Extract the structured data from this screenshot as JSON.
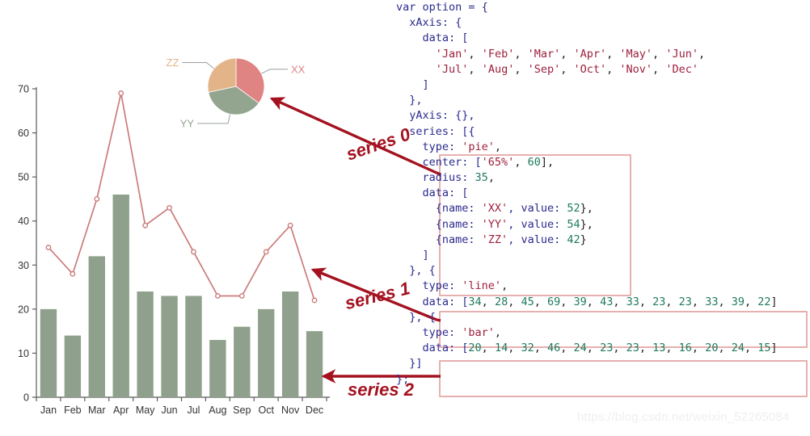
{
  "chart_data": [
    {
      "type": "bar",
      "name": "series 2",
      "categories": [
        "Jan",
        "Feb",
        "Mar",
        "Apr",
        "May",
        "Jun",
        "Jul",
        "Aug",
        "Sep",
        "Oct",
        "Nov",
        "Dec"
      ],
      "values": [
        20,
        14,
        32,
        46,
        24,
        23,
        23,
        13,
        16,
        20,
        24,
        15
      ],
      "title": "",
      "xlabel": "",
      "ylabel": "",
      "ylim": [
        0,
        70
      ],
      "yticks": [
        0,
        10,
        20,
        30,
        40,
        50,
        60,
        70
      ],
      "grid": false,
      "legend": "none",
      "color": "#8fa08c"
    },
    {
      "type": "line",
      "name": "series 1",
      "categories": [
        "Jan",
        "Feb",
        "Mar",
        "Apr",
        "May",
        "Jun",
        "Jul",
        "Aug",
        "Sep",
        "Oct",
        "Nov",
        "Dec"
      ],
      "values": [
        34,
        28,
        45,
        69,
        39,
        43,
        33,
        23,
        23,
        33,
        39,
        22
      ],
      "title": "",
      "xlabel": "",
      "ylabel": "",
      "ylim": [
        0,
        70
      ],
      "grid": false,
      "legend": "none",
      "color": "#cc7b7b",
      "marker": "open-circle"
    },
    {
      "type": "pie",
      "name": "series 0",
      "categories": [
        "XX",
        "YY",
        "ZZ"
      ],
      "values": [
        52,
        54,
        42
      ],
      "labels": [
        "XX",
        "YY",
        "ZZ"
      ],
      "colors": [
        "#e08383",
        "#93a48f",
        "#e4b489"
      ],
      "center": [
        "65%",
        60
      ],
      "radius": 35,
      "legend": "labels-with-leader-lines"
    }
  ],
  "pie_labels": {
    "xx": "XX",
    "yy": "YY",
    "zz": "ZZ"
  },
  "axis": {
    "y_ticks": [
      "70",
      "60",
      "50",
      "40",
      "30",
      "20",
      "10",
      "0"
    ],
    "x_ticks": [
      "Jan",
      "Feb",
      "Mar",
      "Apr",
      "May",
      "Jun",
      "Jul",
      "Aug",
      "Sep",
      "Oct",
      "Nov",
      "Dec"
    ]
  },
  "annotations": {
    "series0": "series 0",
    "series1": "series 1",
    "series2": "series 2"
  },
  "code": {
    "lines": [
      [
        {
          "t": "var option = {",
          "c": "k"
        }
      ],
      [
        {
          "t": "  xAxis: {",
          "c": "k"
        }
      ],
      [
        {
          "t": "    data: [",
          "c": "k"
        }
      ],
      [
        {
          "t": "      ",
          "c": "p"
        },
        {
          "t": "'Jan'",
          "c": "s"
        },
        {
          "t": ", ",
          "c": "p"
        },
        {
          "t": "'Feb'",
          "c": "s"
        },
        {
          "t": ", ",
          "c": "p"
        },
        {
          "t": "'Mar'",
          "c": "s"
        },
        {
          "t": ", ",
          "c": "p"
        },
        {
          "t": "'Apr'",
          "c": "s"
        },
        {
          "t": ", ",
          "c": "p"
        },
        {
          "t": "'May'",
          "c": "s"
        },
        {
          "t": ", ",
          "c": "p"
        },
        {
          "t": "'Jun'",
          "c": "s"
        },
        {
          "t": ",",
          "c": "p"
        }
      ],
      [
        {
          "t": "      ",
          "c": "p"
        },
        {
          "t": "'Jul'",
          "c": "s"
        },
        {
          "t": ", ",
          "c": "p"
        },
        {
          "t": "'Aug'",
          "c": "s"
        },
        {
          "t": ", ",
          "c": "p"
        },
        {
          "t": "'Sep'",
          "c": "s"
        },
        {
          "t": ", ",
          "c": "p"
        },
        {
          "t": "'Oct'",
          "c": "s"
        },
        {
          "t": ", ",
          "c": "p"
        },
        {
          "t": "'Nov'",
          "c": "s"
        },
        {
          "t": ", ",
          "c": "p"
        },
        {
          "t": "'Dec'",
          "c": "s"
        }
      ],
      [
        {
          "t": "    ]",
          "c": "k"
        }
      ],
      [
        {
          "t": "  },",
          "c": "k"
        }
      ],
      [
        {
          "t": "  yAxis: {},",
          "c": "k"
        }
      ],
      [
        {
          "t": "  series: [{",
          "c": "k"
        }
      ],
      [
        {
          "t": "    type: ",
          "c": "k"
        },
        {
          "t": "'pie'",
          "c": "s"
        },
        {
          "t": ",",
          "c": "p"
        }
      ],
      [
        {
          "t": "    center: [",
          "c": "k"
        },
        {
          "t": "'65%'",
          "c": "s"
        },
        {
          "t": ", ",
          "c": "p"
        },
        {
          "t": "60",
          "c": "n"
        },
        {
          "t": "],",
          "c": "p"
        }
      ],
      [
        {
          "t": "    radius: ",
          "c": "k"
        },
        {
          "t": "35",
          "c": "n"
        },
        {
          "t": ",",
          "c": "p"
        }
      ],
      [
        {
          "t": "    data: [",
          "c": "k"
        }
      ],
      [
        {
          "t": "      {name: ",
          "c": "k"
        },
        {
          "t": "'XX'",
          "c": "s"
        },
        {
          "t": ", value: ",
          "c": "k"
        },
        {
          "t": "52",
          "c": "n"
        },
        {
          "t": "},",
          "c": "p"
        }
      ],
      [
        {
          "t": "      {name: ",
          "c": "k"
        },
        {
          "t": "'YY'",
          "c": "s"
        },
        {
          "t": ", value: ",
          "c": "k"
        },
        {
          "t": "54",
          "c": "n"
        },
        {
          "t": "},",
          "c": "p"
        }
      ],
      [
        {
          "t": "      {name: ",
          "c": "k"
        },
        {
          "t": "'ZZ'",
          "c": "s"
        },
        {
          "t": ", value: ",
          "c": "k"
        },
        {
          "t": "42",
          "c": "n"
        },
        {
          "t": "}",
          "c": "p"
        }
      ],
      [
        {
          "t": "    ]",
          "c": "k"
        }
      ],
      [
        {
          "t": "  }, {",
          "c": "k"
        }
      ],
      [
        {
          "t": "    type: ",
          "c": "k"
        },
        {
          "t": "'line'",
          "c": "s"
        },
        {
          "t": ",",
          "c": "p"
        }
      ],
      [
        {
          "t": "    data: [",
          "c": "k"
        },
        {
          "t": "34",
          "c": "n"
        },
        {
          "t": ", ",
          "c": "p"
        },
        {
          "t": "28",
          "c": "n"
        },
        {
          "t": ", ",
          "c": "p"
        },
        {
          "t": "45",
          "c": "n"
        },
        {
          "t": ", ",
          "c": "p"
        },
        {
          "t": "69",
          "c": "n"
        },
        {
          "t": ", ",
          "c": "p"
        },
        {
          "t": "39",
          "c": "n"
        },
        {
          "t": ", ",
          "c": "p"
        },
        {
          "t": "43",
          "c": "n"
        },
        {
          "t": ", ",
          "c": "p"
        },
        {
          "t": "33",
          "c": "n"
        },
        {
          "t": ", ",
          "c": "p"
        },
        {
          "t": "23",
          "c": "n"
        },
        {
          "t": ", ",
          "c": "p"
        },
        {
          "t": "23",
          "c": "n"
        },
        {
          "t": ", ",
          "c": "p"
        },
        {
          "t": "33",
          "c": "n"
        },
        {
          "t": ", ",
          "c": "p"
        },
        {
          "t": "39",
          "c": "n"
        },
        {
          "t": ", ",
          "c": "p"
        },
        {
          "t": "22",
          "c": "n"
        },
        {
          "t": "]",
          "c": "p"
        }
      ],
      [
        {
          "t": "  }, {",
          "c": "k"
        }
      ],
      [
        {
          "t": "    type: ",
          "c": "k"
        },
        {
          "t": "'bar'",
          "c": "s"
        },
        {
          "t": ",",
          "c": "p"
        }
      ],
      [
        {
          "t": "    data: [",
          "c": "k"
        },
        {
          "t": "20",
          "c": "n"
        },
        {
          "t": ", ",
          "c": "p"
        },
        {
          "t": "14",
          "c": "n"
        },
        {
          "t": ", ",
          "c": "p"
        },
        {
          "t": "32",
          "c": "n"
        },
        {
          "t": ", ",
          "c": "p"
        },
        {
          "t": "46",
          "c": "n"
        },
        {
          "t": ", ",
          "c": "p"
        },
        {
          "t": "24",
          "c": "n"
        },
        {
          "t": ", ",
          "c": "p"
        },
        {
          "t": "23",
          "c": "n"
        },
        {
          "t": ", ",
          "c": "p"
        },
        {
          "t": "23",
          "c": "n"
        },
        {
          "t": ", ",
          "c": "p"
        },
        {
          "t": "13",
          "c": "n"
        },
        {
          "t": ", ",
          "c": "p"
        },
        {
          "t": "16",
          "c": "n"
        },
        {
          "t": ", ",
          "c": "p"
        },
        {
          "t": "20",
          "c": "n"
        },
        {
          "t": ", ",
          "c": "p"
        },
        {
          "t": "24",
          "c": "n"
        },
        {
          "t": ", ",
          "c": "p"
        },
        {
          "t": "15",
          "c": "n"
        },
        {
          "t": "]",
          "c": "p"
        }
      ],
      [
        {
          "t": "  }]",
          "c": "k"
        }
      ],
      [
        {
          "t": "};",
          "c": "k"
        }
      ]
    ]
  },
  "watermark": "https://blog.csdn.net/weixin_52265084"
}
